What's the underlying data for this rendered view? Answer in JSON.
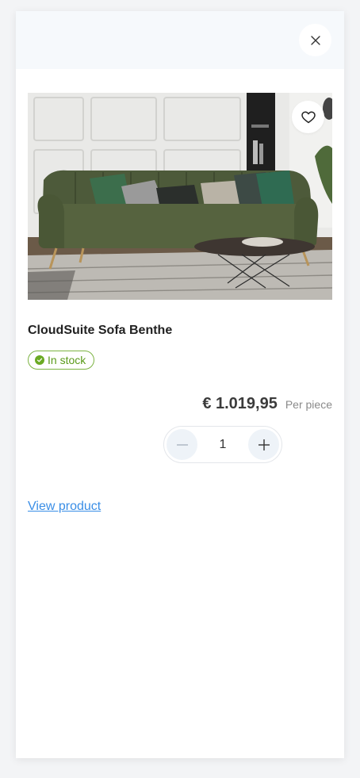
{
  "panel": {
    "close_icon": "close-icon",
    "favorite_icon": "heart-icon"
  },
  "product": {
    "title": "CloudSuite Sofa Benthe",
    "stock_label": "In stock",
    "stock_icon": "check-circle-icon",
    "price": "€ 1.019,95",
    "price_unit": "Per piece",
    "quantity": "1",
    "view_link": "View product"
  },
  "colors": {
    "stock_green": "#6aaa23",
    "link_blue": "#3a8ee6",
    "header_bg": "#f6f9fc"
  }
}
